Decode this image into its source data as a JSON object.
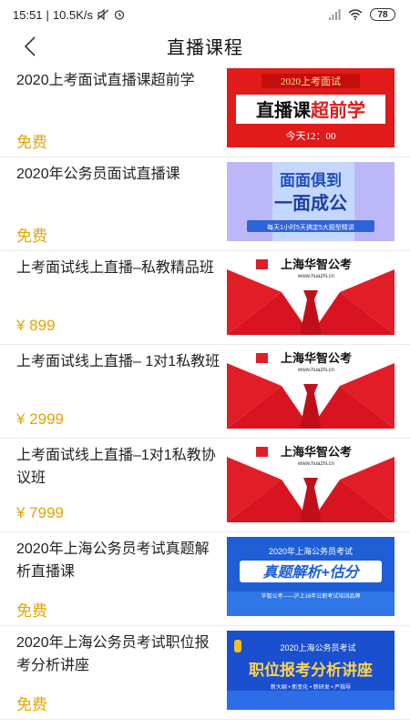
{
  "status": {
    "time": "15:51",
    "speed": "10.5K/s",
    "battery": "78"
  },
  "nav": {
    "title": "直播课程"
  },
  "courses": [
    {
      "title": "2020上考面试直播课超前学",
      "price": "免费",
      "thumb": {
        "l1": "2020上考面试",
        "l2a": "直播课",
        "l2b": "超前学",
        "l3": "今天12：00"
      }
    },
    {
      "title": "2020年公务员面试直播课",
      "price": "免费",
      "thumb": {
        "l1": "面面俱到",
        "l2": "一面成公",
        "l3": "每天1小时5天搞定5大题型精讲"
      }
    },
    {
      "title": "上考面试线上直播–私教精品班",
      "price": "¥ 899",
      "thumb": {
        "brand": "上海华智公考",
        "url": "www.huazhi.cn"
      }
    },
    {
      "title": "上考面试线上直播– 1对1私教班",
      "price": "¥ 2999",
      "thumb": {
        "brand": "上海华智公考",
        "url": "www.huazhi.cn"
      }
    },
    {
      "title": "上考面试线上直播–1对1私教协议班",
      "price": "¥ 7999",
      "thumb": {
        "brand": "上海华智公考",
        "url": "www.huazhi.cn"
      }
    },
    {
      "title": "2020年上海公务员考试真题解析直播课",
      "price": "免费",
      "thumb": {
        "l1": "2020年上海公务员考试",
        "l2": "真题解析+估分",
        "l3": "华智公考——沪上16年公职考试培训品牌"
      }
    },
    {
      "title": "2020年上海公务员考试职位报考分析讲座",
      "price": "免费",
      "thumb": {
        "l1": "2020上海公务员考试",
        "l2": "职位报考分析讲座",
        "l3": "新大纲 • 新变化 • 新研发 • 严指导"
      }
    }
  ]
}
